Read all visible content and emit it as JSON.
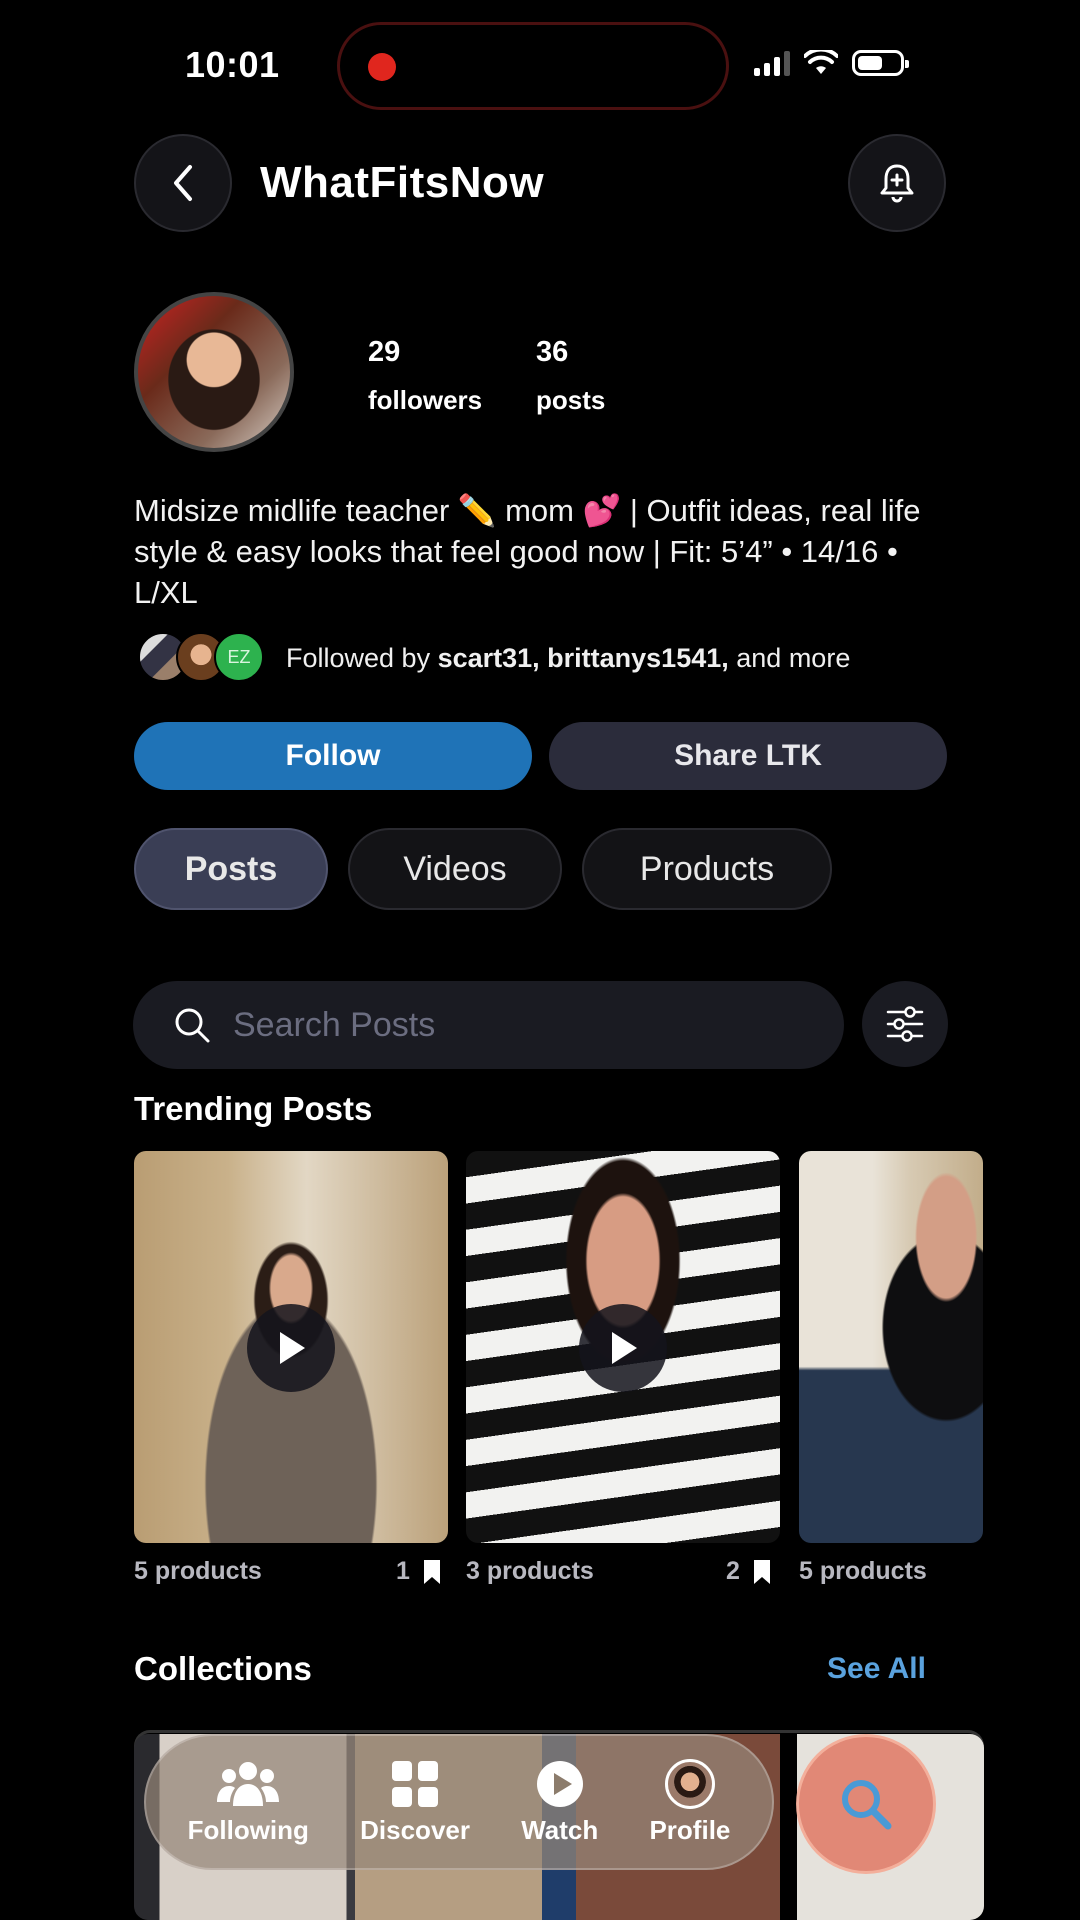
{
  "status_bar": {
    "time": "10:01"
  },
  "header": {
    "title": "WhatFitsNow",
    "back_icon": "chevron-left-icon",
    "bell_icon": "bell-plus-icon"
  },
  "profile": {
    "followers_count": "29",
    "followers_label": "followers",
    "posts_count": "36",
    "posts_label": "posts",
    "bio": "Midsize midlife teacher ✏️ mom 💕 | Outfit ideas, real life style & easy looks that feel good now | Fit: 5’4” • 14/16 • L/XL",
    "followed_by_prefix": "Followed by ",
    "followed_by_names": "scart31, brittanys1541,",
    "followed_by_suffix": " and more",
    "mini_avatar_initials": "EZ"
  },
  "actions": {
    "follow_label": "Follow",
    "share_label": "Share LTK",
    "follow_color": "#1f73b7"
  },
  "tabs": [
    {
      "label": "Posts",
      "active": true
    },
    {
      "label": "Videos",
      "active": false
    },
    {
      "label": "Products",
      "active": false
    }
  ],
  "search": {
    "placeholder": "Search Posts",
    "value": ""
  },
  "trending": {
    "title": "Trending Posts",
    "posts": [
      {
        "products": "5 products",
        "bookmarks": "1",
        "is_video": true
      },
      {
        "products": "3 products",
        "bookmarks": "2",
        "is_video": true
      },
      {
        "products": "5 products",
        "bookmarks": "",
        "is_video": false
      }
    ]
  },
  "collections": {
    "title": "Collections",
    "see_all": "See All",
    "see_all_color": "#5aa2de"
  },
  "bottom_nav": {
    "items": [
      {
        "label": "Following",
        "icon": "people-icon"
      },
      {
        "label": "Discover",
        "icon": "grid-icon"
      },
      {
        "label": "Watch",
        "icon": "play-circle-icon"
      },
      {
        "label": "Profile",
        "icon": "avatar"
      }
    ],
    "search_icon": "search-icon"
  }
}
